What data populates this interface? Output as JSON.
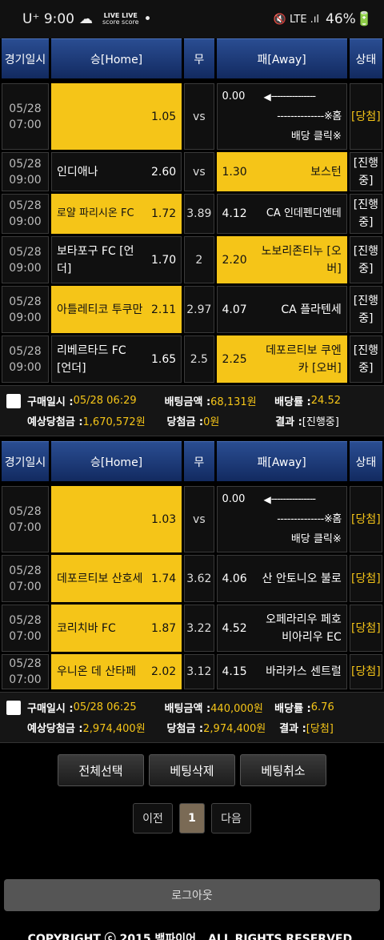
{
  "status": {
    "carrier": "U⁺ 9:00",
    "live1": "LIVE LIVE",
    "live2": "score score",
    "dot": "•",
    "icons": "🔇 LTE .ıl",
    "battery": "46%🔋"
  },
  "header": {
    "date": "경기일시",
    "home": "승[Home]",
    "draw": "무",
    "away": "패[Away]",
    "state": "상태"
  },
  "slip1": {
    "bonus": {
      "date": "05/28",
      "time": "07:00",
      "home_odds": "1.05",
      "vs": "vs",
      "away_odds": "0.00",
      "arrow": "◀",
      "dash1": "---------------",
      "dash2": "--------------※홈",
      "click": "배당 클릭※",
      "result": "[당첨]"
    },
    "rows": [
      {
        "date": "05/28",
        "time": "09:00",
        "home": "인디애나",
        "home_odds": "2.60",
        "mid": "vs",
        "away_odds": "1.30",
        "away": "보스턴",
        "result": "[진행중]"
      },
      {
        "date": "05/28",
        "time": "09:00",
        "home": "로얄 파리시온 FC",
        "home_odds": "1.72",
        "mid": "3.89",
        "away_odds": "4.12",
        "away": "CA 인데펜디엔테",
        "result": "[진행중]"
      },
      {
        "date": "05/28",
        "time": "09:00",
        "home": "보타포구 FC [언더]",
        "home_odds": "1.70",
        "mid": "2",
        "away_odds": "2.20",
        "away": "노보리존티누 [오버]",
        "result": "[진행중]"
      },
      {
        "date": "05/28",
        "time": "09:00",
        "home": "아틀레티코 투쿠만",
        "home_odds": "2.11",
        "mid": "2.97",
        "away_odds": "4.07",
        "away": "CA 플라텐세",
        "result": "[진행중]"
      },
      {
        "date": "05/28",
        "time": "09:00",
        "home": "리베르타드 FC [언더]",
        "home_odds": "1.65",
        "mid": "2.5",
        "away_odds": "2.25",
        "away": "데포르티보 쿠엔카 [오버]",
        "result": "[진행중]"
      }
    ],
    "summary": {
      "buy_label": "구매일시 : ",
      "buy_value": "05/28 06:29",
      "bet_label": "배팅금액 : ",
      "bet_value": "68,131원",
      "odds_label": "배당률 : ",
      "odds_value": "24.52",
      "expect_label": "예상당첨금 : ",
      "expect_value": "1,670,572원",
      "win_label": "당첨금 : ",
      "win_value": "0원",
      "result_label": "결과 : ",
      "result_value": "[진행중]"
    }
  },
  "slip2": {
    "bonus": {
      "date": "05/28",
      "time": "07:00",
      "home_odds": "1.03",
      "vs": "vs",
      "away_odds": "0.00",
      "arrow": "◀",
      "dash1": "---------------",
      "dash2": "--------------※홈",
      "click": "배당 클릭※",
      "result": "[당첨]"
    },
    "rows": [
      {
        "date": "05/28",
        "time": "07:00",
        "home": "데포르티보 산호세",
        "home_odds": "1.74",
        "mid": "3.62",
        "away_odds": "4.06",
        "away": "산 안토니오 불로",
        "result": "[당첨]"
      },
      {
        "date": "05/28",
        "time": "07:00",
        "home": "코리치바 FC",
        "home_odds": "1.87",
        "mid": "3.22",
        "away_odds": "4.52",
        "away": "오페라리우 페호비아리우 EC",
        "result": "[당첨]"
      },
      {
        "date": "05/28",
        "time": "07:00",
        "home": "우니온 데 산타페",
        "home_odds": "2.02",
        "mid": "3.12",
        "away_odds": "4.15",
        "away": "바라카스 센트럴",
        "result": "[당첨]"
      }
    ],
    "summary": {
      "buy_label": "구매일시 : ",
      "buy_value": "05/28 06:25",
      "bet_label": "배팅금액 : ",
      "bet_value": "440,000원",
      "odds_label": "배당률 : ",
      "odds_value": "6.76",
      "expect_label": "예상당첨금 : ",
      "expect_value": "2,974,400원",
      "win_label": "당첨금 : ",
      "win_value": "2,974,400원",
      "result_label": "결과 : ",
      "result_value": "[당첨]"
    }
  },
  "buttons": {
    "select_all": "전체선택",
    "delete": "베팅삭제",
    "cancel": "베팅취소"
  },
  "pager": {
    "prev": "이전",
    "current": "1",
    "next": "다음"
  },
  "logout": "로그아웃",
  "copyright": "COPYRIGHT ⓒ 2015 뱀파이어 . ALL RIGHTS RESERVED."
}
